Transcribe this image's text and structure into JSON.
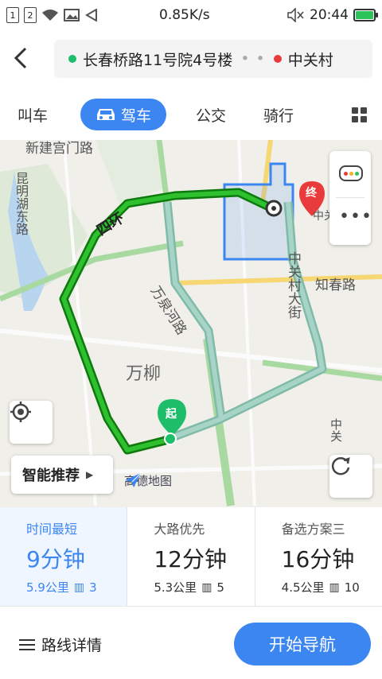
{
  "status_bar": {
    "sim1": "1",
    "sim2": "2",
    "speed": "0.85K/s",
    "time": "20:44"
  },
  "header": {
    "origin": "长春桥路11号院4号楼",
    "destination": "中关村",
    "separator": "• •"
  },
  "tabs": [
    {
      "label": "叫车"
    },
    {
      "label": "驾车",
      "active": true
    },
    {
      "label": "公交"
    },
    {
      "label": "骑行"
    }
  ],
  "map": {
    "labels": {
      "xinjiangongmen": "新建宫门路",
      "kunming": "昆明湖东路",
      "sihuan": "四环",
      "wanquanhe": "万泉河路",
      "zhongguancun_street": "中关村大街",
      "zhichun": "知春路",
      "wanliu": "万柳",
      "zhongguancun_short": "中关",
      "qi": "起",
      "zhong": "终",
      "zhong_right": "中关"
    },
    "smart_recommend": "智能推荐",
    "brand": "高德地图"
  },
  "routes": [
    {
      "tag": "时间最短",
      "time": "9分钟",
      "distance": "5.9公里",
      "lights": "3",
      "active": true
    },
    {
      "tag": "大路优先",
      "time": "12分钟",
      "distance": "5.3公里",
      "lights": "5"
    },
    {
      "tag": "备选方案三",
      "time": "16分钟",
      "distance": "4.5公里",
      "lights": "10"
    }
  ],
  "bottom": {
    "detail": "路线详情",
    "start": "开始导航"
  },
  "colors": {
    "accent": "#3c86f2",
    "route_main": "#1a9e1a",
    "route_alt": "#8fc2b4",
    "start_green": "#1dbd6a",
    "end_red": "#e83c3c"
  }
}
